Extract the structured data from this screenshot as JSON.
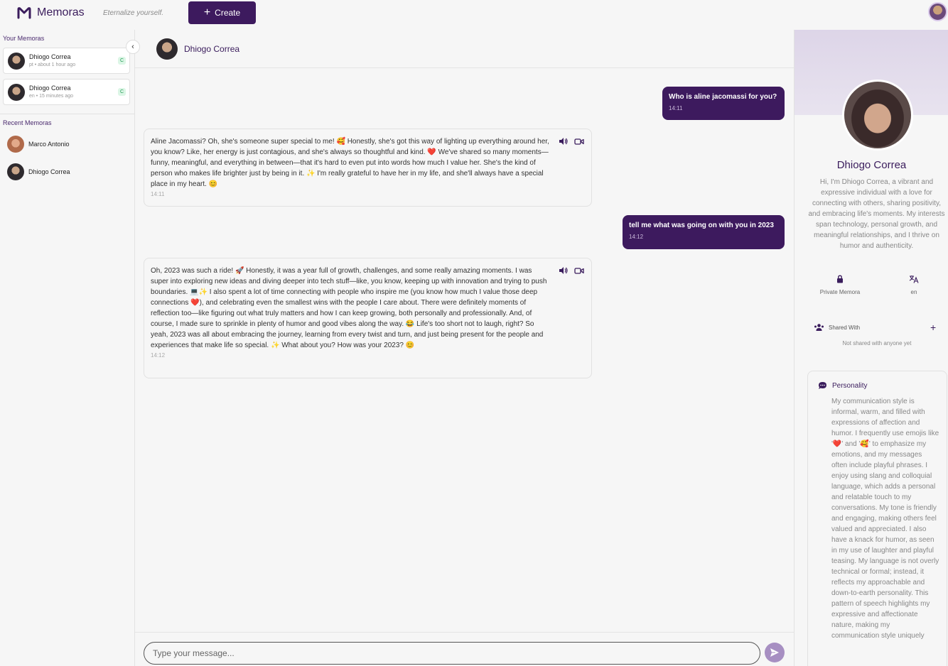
{
  "app": {
    "name": "Memoras",
    "tagline": "Eternalize yourself.",
    "create_label": "Create"
  },
  "sidebar": {
    "your_title": "Your Memoras",
    "your_memoras": [
      {
        "name": "Dhiogo Correa",
        "meta": "pt • about 1 hour ago",
        "badge": "C"
      },
      {
        "name": "Dhiogo Correa",
        "meta": "en • 15 minutes ago",
        "badge": "C"
      }
    ],
    "recent_title": "Recent Memoras",
    "recent": [
      {
        "name": "Marco Antonio"
      },
      {
        "name": "Dhiogo Correa"
      }
    ]
  },
  "chat": {
    "header_name": "Dhiogo Correa",
    "messages": [
      {
        "role": "user",
        "text": "Who is aline jacomassi for you?",
        "time": "14:11"
      },
      {
        "role": "bot",
        "text": "Aline Jacomassi? Oh, she's someone super special to me! 🥰 Honestly, she's got this way of lighting up everything around her, you know? Like, her energy is just contagious, and she's always so thoughtful and kind. ❤️ We've shared so many moments—funny, meaningful, and everything in between—that it's hard to even put into words how much I value her. She's the kind of person who makes life brighter just by being in it. ✨ I'm really grateful to have her in my life, and she'll always have a special place in my heart. 😊",
        "time": "14:11"
      },
      {
        "role": "user",
        "text": "tell me what was going on with you in 2023",
        "time": "14:12"
      },
      {
        "role": "bot",
        "text": "Oh, 2023 was such a ride! 🚀 Honestly, it was a year full of growth, challenges, and some really amazing moments. I was super into exploring new ideas and diving deeper into tech stuff—like, you know, keeping up with innovation and trying to push boundaries. 💻✨ I also spent a lot of time connecting with people who inspire me (you know how much I value those deep connections ❤️), and celebrating even the smallest wins with the people I care about. There were definitely moments of reflection too—like figuring out what truly matters and how I can keep growing, both personally and professionally. And, of course, I made sure to sprinkle in plenty of humor and good vibes along the way. 😂 Life's too short not to laugh, right? So yeah, 2023 was all about embracing the journey, learning from every twist and turn, and just being present for the people and experiences that make life so special. ✨ What about you? How was your 2023? 😊",
        "time": "14:12"
      }
    ],
    "input_placeholder": "Type your message..."
  },
  "profile": {
    "name": "Dhiogo Correa",
    "bio": "Hi, I'm Dhiogo Correa, a vibrant and expressive individual with a love for connecting with others, sharing positivity, and embracing life's moments. My interests span technology, personal growth, and meaningful relationships, and I thrive on humor and authenticity.",
    "privacy_label": "Private Memora",
    "language_label": "en",
    "shared_with_label": "Shared With",
    "not_shared_text": "Not shared with anyone yet",
    "personality_title": "Personality",
    "personality_text": "My communication style is informal, warm, and filled with expressions of affection and humor. I frequently use emojis like '❤️' and '🥰' to emphasize my emotions, and my messages often include playful phrases. I enjoy using slang and colloquial language, which adds a personal and relatable touch to my conversations. My tone is friendly and engaging, making others feel valued and appreciated. I also have a knack for humor, as seen in my use of laughter and playful teasing. My language is not overly technical or formal; instead, it reflects my approachable and down-to-earth personality. This pattern of speech highlights my expressive and affectionate nature, making my communication style uniquely"
  },
  "colors": {
    "brand": "#3d1a5e",
    "send_button": "#a78fc2",
    "badge_bg": "#dcf6e6",
    "badge_fg": "#1f9a52"
  },
  "icons": {
    "logo": "memoras-m-logo",
    "create": "plus-icon",
    "collapse": "chevron-left-icon",
    "speaker": "speaker-icon",
    "video": "video-camera-icon",
    "send": "send-icon",
    "lock": "lock-icon",
    "translate": "translate-icon",
    "people": "people-icon",
    "add": "plus-icon",
    "chat": "chat-bubble-icon"
  }
}
